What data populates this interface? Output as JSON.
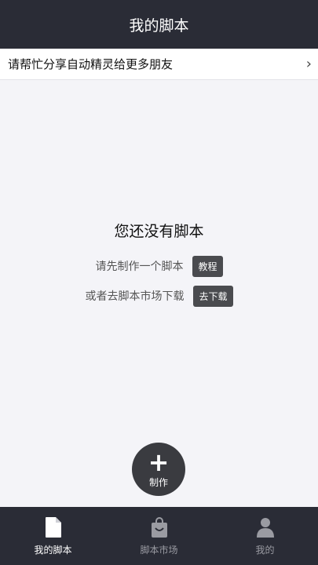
{
  "header": {
    "title": "我的脚本"
  },
  "banner": {
    "text": "请帮忙分享自动精灵给更多朋友",
    "chevron": "›"
  },
  "empty_state": {
    "title": "您还没有脚本",
    "line1": "请先制作一个脚本",
    "tutorial_label": "教程",
    "line2": "或者去脚本市场下载",
    "download_label": "去下载"
  },
  "fab": {
    "plus": "+",
    "label": "制作"
  },
  "tabs": [
    {
      "label": "我的脚本",
      "icon": "document-icon"
    },
    {
      "label": "脚本市场",
      "icon": "shopping-bag-icon"
    },
    {
      "label": "我的",
      "icon": "person-icon"
    }
  ],
  "colors": {
    "header_bg": "#2a2c36",
    "tab_active": "#ffffff",
    "tab_inactive": "#9a9ba2",
    "button_bg": "#4a4b4f"
  }
}
